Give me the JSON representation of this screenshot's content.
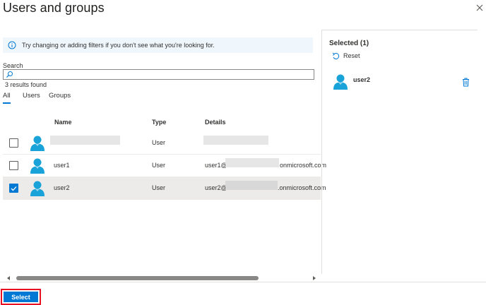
{
  "header": {
    "title": "Users and groups"
  },
  "info": {
    "text": "Try changing or adding filters if you don't see what you're looking for."
  },
  "search": {
    "label": "Search",
    "value": "",
    "placeholder": ""
  },
  "results": {
    "count_text": "3 results found"
  },
  "tabs": [
    {
      "label": "All",
      "active": true
    },
    {
      "label": "Users",
      "active": false
    },
    {
      "label": "Groups",
      "active": false
    }
  ],
  "table": {
    "columns": [
      "Name",
      "Type",
      "Details"
    ],
    "rows": [
      {
        "name": "",
        "type": "User",
        "details_prefix": "",
        "details_suffix": "",
        "checked": false
      },
      {
        "name": "user1",
        "type": "User",
        "details_prefix": "user1@",
        "details_suffix": "onmicrosoft.com",
        "checked": false
      },
      {
        "name": "user2",
        "type": "User",
        "details_prefix": "user2@",
        "details_suffix": ".onmicrosoft.com",
        "checked": true
      }
    ]
  },
  "selected_panel": {
    "title": "Selected (1)",
    "reset_label": "Reset",
    "items": [
      {
        "name": "user2"
      }
    ]
  },
  "footer": {
    "select_label": "Select"
  },
  "colors": {
    "accent": "#0078d4",
    "info_bg": "#eff6fc",
    "highlight": "#e81123",
    "avatar": "#1aa3d9"
  },
  "icons": {
    "info": "info-icon",
    "search": "search-icon",
    "close": "close-icon",
    "reset": "undo-icon",
    "trash": "trash-icon",
    "avatar": "user-avatar-icon"
  }
}
